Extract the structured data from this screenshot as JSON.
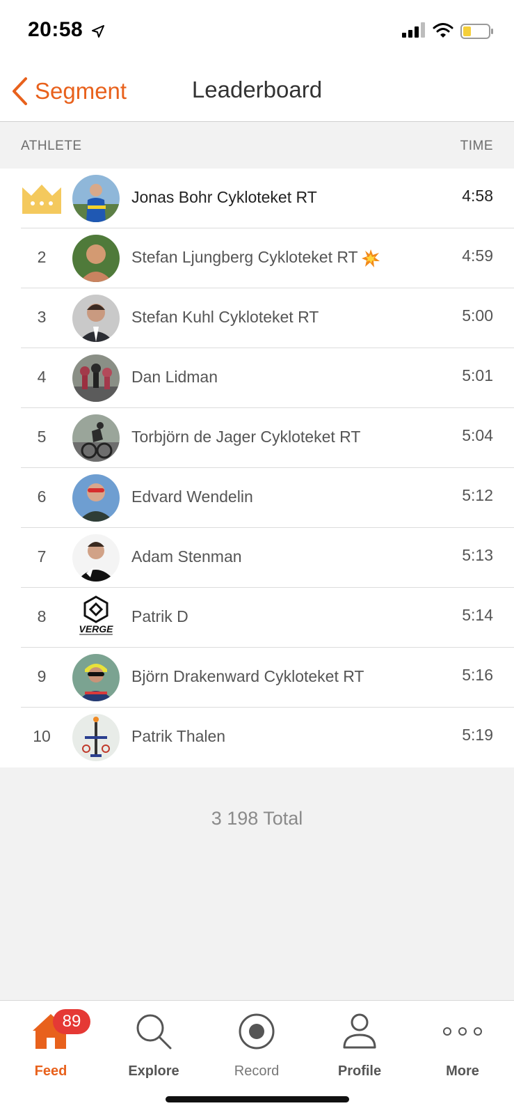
{
  "status_bar": {
    "time": "20:58"
  },
  "nav": {
    "back_label": "Segment",
    "title": "Leaderboard"
  },
  "columns": {
    "athlete": "ATHLETE",
    "time": "TIME"
  },
  "leaderboard": [
    {
      "rank": "",
      "name": "Jonas Bohr Cykloteket RT",
      "time": "4:58",
      "leader": true,
      "avatar_color": "#3b6fb5"
    },
    {
      "rank": "2",
      "name": "Stefan Ljungberg Cykloteket RT",
      "time": "4:59",
      "has_emoji": true,
      "avatar_color": "#b0724f"
    },
    {
      "rank": "3",
      "name": "Stefan Kuhl Cykloteket RT",
      "time": "5:00",
      "avatar_color": "#6b6b6b"
    },
    {
      "rank": "4",
      "name": "Dan Lidman",
      "time": "5:01",
      "avatar_color": "#7a5a5a"
    },
    {
      "rank": "5",
      "name": "Torbjörn de Jager Cykloteket RT",
      "time": "5:04",
      "avatar_color": "#5d6e5a"
    },
    {
      "rank": "6",
      "name": "Edvard Wendelin",
      "time": "5:12",
      "avatar_color": "#4a7fb0"
    },
    {
      "rank": "7",
      "name": "Adam Stenman",
      "time": "5:13",
      "avatar_color": "#2a2a2a"
    },
    {
      "rank": "8",
      "name": "Patrik D",
      "time": "5:14",
      "avatar_color": "#ffffff"
    },
    {
      "rank": "9",
      "name": "Björn Drakenward Cykloteket RT",
      "time": "5:16",
      "avatar_color": "#4b6f5e"
    },
    {
      "rank": "10",
      "name": "Patrik Thalen",
      "time": "5:19",
      "avatar_color": "#e8ece8"
    }
  ],
  "total": "3 198 Total",
  "tabs": [
    {
      "label": "Feed",
      "icon": "home-icon",
      "active": true,
      "badge": "89"
    },
    {
      "label": "Explore",
      "icon": "search-icon"
    },
    {
      "label": "Record",
      "icon": "record-icon"
    },
    {
      "label": "Profile",
      "icon": "profile-icon"
    },
    {
      "label": "More",
      "icon": "more-icon"
    }
  ],
  "colors": {
    "accent": "#e8611c",
    "badge": "#e53935",
    "crown": "#f4c95d"
  },
  "logo_texts": {
    "verge": "VERGE"
  }
}
